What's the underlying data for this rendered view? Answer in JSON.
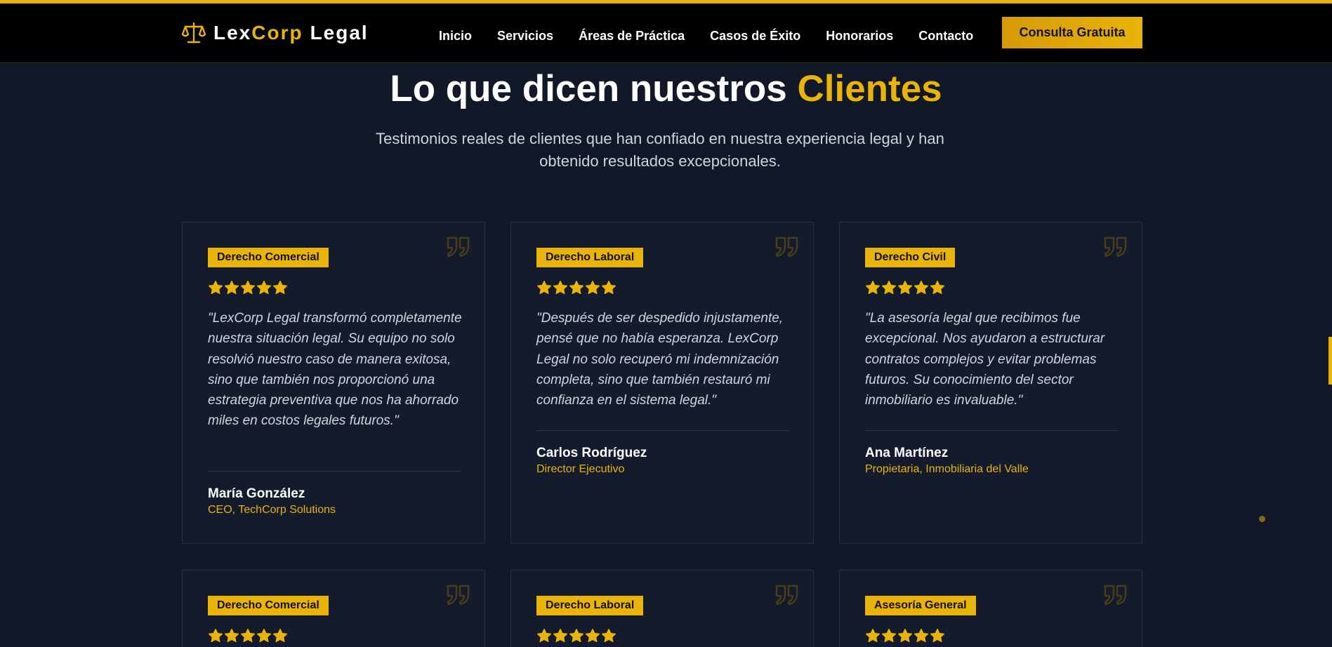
{
  "colors": {
    "accent": "#eab308",
    "background": "#111827",
    "header": "#000000",
    "card": "#131b2c"
  },
  "header": {
    "brand": {
      "part1": "Lex",
      "part2": "Corp",
      "part3": "Legal",
      "icon": "scales-of-justice-icon"
    },
    "nav": [
      "Inicio",
      "Servicios",
      "Áreas de Práctica",
      "Casos de Éxito",
      "Honorarios",
      "Contacto"
    ],
    "cta": "Consulta Gratuita"
  },
  "section": {
    "title_main": "Lo que dicen nuestros",
    "title_accent": "Clientes",
    "subtitle": "Testimonios reales de clientes que han confiado en nuestra experiencia legal y han obtenido resultados excepcionales."
  },
  "testimonials": [
    {
      "category": "Derecho Comercial",
      "rating": 5,
      "quote": "\"LexCorp Legal transformó completamente nuestra situación legal. Su equipo no solo resolvió nuestro caso de manera exitosa, sino que también nos proporcionó una estrategia preventiva que nos ha ahorrado miles en costos legales futuros.\"",
      "author": "María González",
      "role": "CEO, TechCorp Solutions"
    },
    {
      "category": "Derecho Laboral",
      "rating": 5,
      "quote": "\"Después de ser despedido injustamente, pensé que no había esperanza. LexCorp Legal no solo recuperó mi indemnización completa, sino que también restauró mi confianza en el sistema legal.\"",
      "author": "Carlos Rodríguez",
      "role": "Director Ejecutivo"
    },
    {
      "category": "Derecho Civil",
      "rating": 5,
      "quote": "\"La asesoría legal que recibimos fue excepcional. Nos ayudaron a estructurar contratos complejos y evitar problemas futuros. Su conocimiento del sector inmobiliario es invaluable.\"",
      "author": "Ana Martínez",
      "role": "Propietaria, Inmobiliaria del Valle"
    },
    {
      "category": "Derecho Comercial",
      "rating": 5
    },
    {
      "category": "Derecho Laboral",
      "rating": 5
    },
    {
      "category": "Asesoría General",
      "rating": 5
    }
  ]
}
